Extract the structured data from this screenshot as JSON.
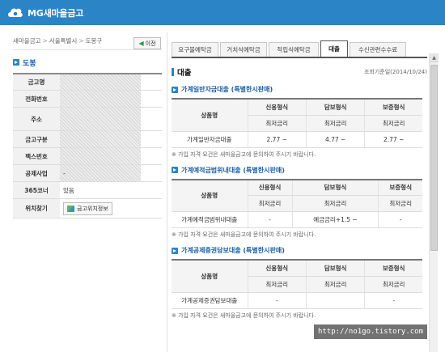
{
  "header": {
    "logo_text": "MG새마을금고"
  },
  "breadcrumb": {
    "items": [
      "새마을금고",
      "서울특별시",
      "도봉구"
    ],
    "separator": ">",
    "back_label": "이전"
  },
  "branch": {
    "title": "도봉",
    "rows": [
      {
        "label": "금고명",
        "value": ""
      },
      {
        "label": "전화번호",
        "value": ""
      },
      {
        "label": "주소",
        "value": ""
      },
      {
        "label": "금고구분",
        "value": ""
      },
      {
        "label": "팩스번호",
        "value": ""
      },
      {
        "label": "공제사업",
        "value": "-"
      },
      {
        "label": "365코너",
        "value": "있음"
      },
      {
        "label": "위치찾기",
        "value": ""
      }
    ],
    "map_button_label": "금고위치정보"
  },
  "tabs": [
    "요구불예탁금",
    "거치식예탁금",
    "적립식예탁금",
    "대출",
    "수신관련수수료"
  ],
  "active_tab": "대출",
  "loan": {
    "title": "대출",
    "as_of": "조회기준일(2014/10/24)",
    "col_product": "상품명",
    "col_credit": "신용형식",
    "col_collateral": "담보형식",
    "col_guarantee": "보증형식",
    "col_min_rate": "최저금리",
    "note": "※ 가입 자격 요건은 새마을금고에 문의하여 주시기 바랍니다.",
    "sections": [
      {
        "title": "가계일반자금대출 (특별한시판매)",
        "product": "가계일반자금대출",
        "credit": "2.77 ~",
        "collateral": "4.77 ~",
        "guarantee": "2.77 ~"
      },
      {
        "title": "가계예적금범위내대출 (특별한시판매)",
        "product": "가계예적금범위내대출",
        "credit": "-",
        "collateral": "예금금리+1.5 ~",
        "guarantee": "-"
      },
      {
        "title": "가계공제증권담보대출 (특별한시판매)",
        "product": "가계공제증권담보대출",
        "credit": "-",
        "collateral": "",
        "guarantee": "-"
      }
    ]
  },
  "watermark": "http://no1go.tistory.com",
  "colors": {
    "brand": "#2a84c6",
    "title_blue": "#1a5fa8"
  }
}
